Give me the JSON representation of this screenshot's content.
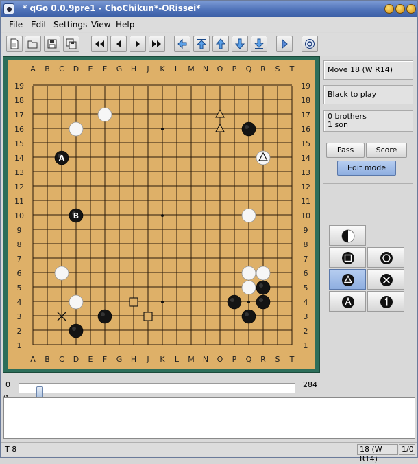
{
  "window": {
    "title": "* qGo 0.0.9pre1 - ChoChikun*-ORissei*"
  },
  "menu": [
    "File",
    "Edit",
    "Settings",
    "View",
    "Help"
  ],
  "toolbar": {
    "buttons": [
      "new-file-icon",
      "open-file-icon",
      "save-icon",
      "save-as-icon",
      "first-move-icon",
      "previous-move-icon",
      "next-move-icon",
      "last-move-icon",
      "previous-variation-icon",
      "main-branch-icon",
      "up-branch-icon",
      "down-branch-icon",
      "next-variation-icon",
      "play-icon",
      "about-icon"
    ]
  },
  "board": {
    "columns": [
      "A",
      "B",
      "C",
      "D",
      "E",
      "F",
      "G",
      "H",
      "J",
      "K",
      "L",
      "M",
      "N",
      "O",
      "P",
      "Q",
      "R",
      "S",
      "T"
    ],
    "rows": [
      "19",
      "18",
      "17",
      "16",
      "15",
      "14",
      "13",
      "12",
      "11",
      "10",
      "9",
      "8",
      "7",
      "6",
      "5",
      "4",
      "3",
      "2",
      "1"
    ],
    "colors": {
      "wood": "#deb068",
      "frame": "#2d6e5a",
      "line": "#2a1a0a"
    },
    "stones": [
      {
        "col": "F",
        "row": 17,
        "color": "white"
      },
      {
        "col": "D",
        "row": 16,
        "color": "white"
      },
      {
        "col": "Q",
        "row": 16,
        "color": "black"
      },
      {
        "col": "C",
        "row": 14,
        "color": "black",
        "label": "A"
      },
      {
        "col": "R",
        "row": 14,
        "color": "white",
        "mark": "triangle"
      },
      {
        "col": "D",
        "row": 10,
        "color": "black",
        "label": "B"
      },
      {
        "col": "Q",
        "row": 10,
        "color": "white"
      },
      {
        "col": "C",
        "row": 6,
        "color": "white"
      },
      {
        "col": "Q",
        "row": 6,
        "color": "white"
      },
      {
        "col": "R",
        "row": 6,
        "color": "white"
      },
      {
        "col": "Q",
        "row": 5,
        "color": "white"
      },
      {
        "col": "R",
        "row": 5,
        "color": "black"
      },
      {
        "col": "D",
        "row": 4,
        "color": "white"
      },
      {
        "col": "P",
        "row": 4,
        "color": "black"
      },
      {
        "col": "R",
        "row": 4,
        "color": "black"
      },
      {
        "col": "F",
        "row": 3,
        "color": "black"
      },
      {
        "col": "Q",
        "row": 3,
        "color": "black"
      },
      {
        "col": "D",
        "row": 2,
        "color": "black"
      }
    ],
    "marks": [
      {
        "col": "O",
        "row": 17,
        "type": "triangle"
      },
      {
        "col": "O",
        "row": 16,
        "type": "triangle"
      },
      {
        "col": "H",
        "row": 4,
        "type": "square"
      },
      {
        "col": "J",
        "row": 3,
        "type": "square"
      },
      {
        "col": "C",
        "row": 3,
        "type": "cross"
      }
    ],
    "hoshi": [
      [
        "D",
        16
      ],
      [
        "K",
        16
      ],
      [
        "Q",
        16
      ],
      [
        "D",
        10
      ],
      [
        "K",
        10
      ],
      [
        "Q",
        10
      ],
      [
        "D",
        4
      ],
      [
        "K",
        4
      ],
      [
        "Q",
        4
      ]
    ]
  },
  "info": {
    "move": "Move 18 (W R14)",
    "to_play": "Black to play",
    "brothers": "0 brothers",
    "sons": "1 son"
  },
  "buttons": {
    "pass": "Pass",
    "score": "Score",
    "edit_mode": "Edit mode"
  },
  "edit_tools": [
    "stone-icon",
    "square-mark-icon",
    "circle-mark-icon",
    "triangle-mark-icon",
    "cross-mark-icon",
    "letter-mark-icon",
    "number-mark-icon"
  ],
  "slider": {
    "min": "0",
    "max": "284",
    "value": 18
  },
  "status": {
    "left": "T 8",
    "move": "18 (W R14)",
    "variation": "1/0"
  }
}
